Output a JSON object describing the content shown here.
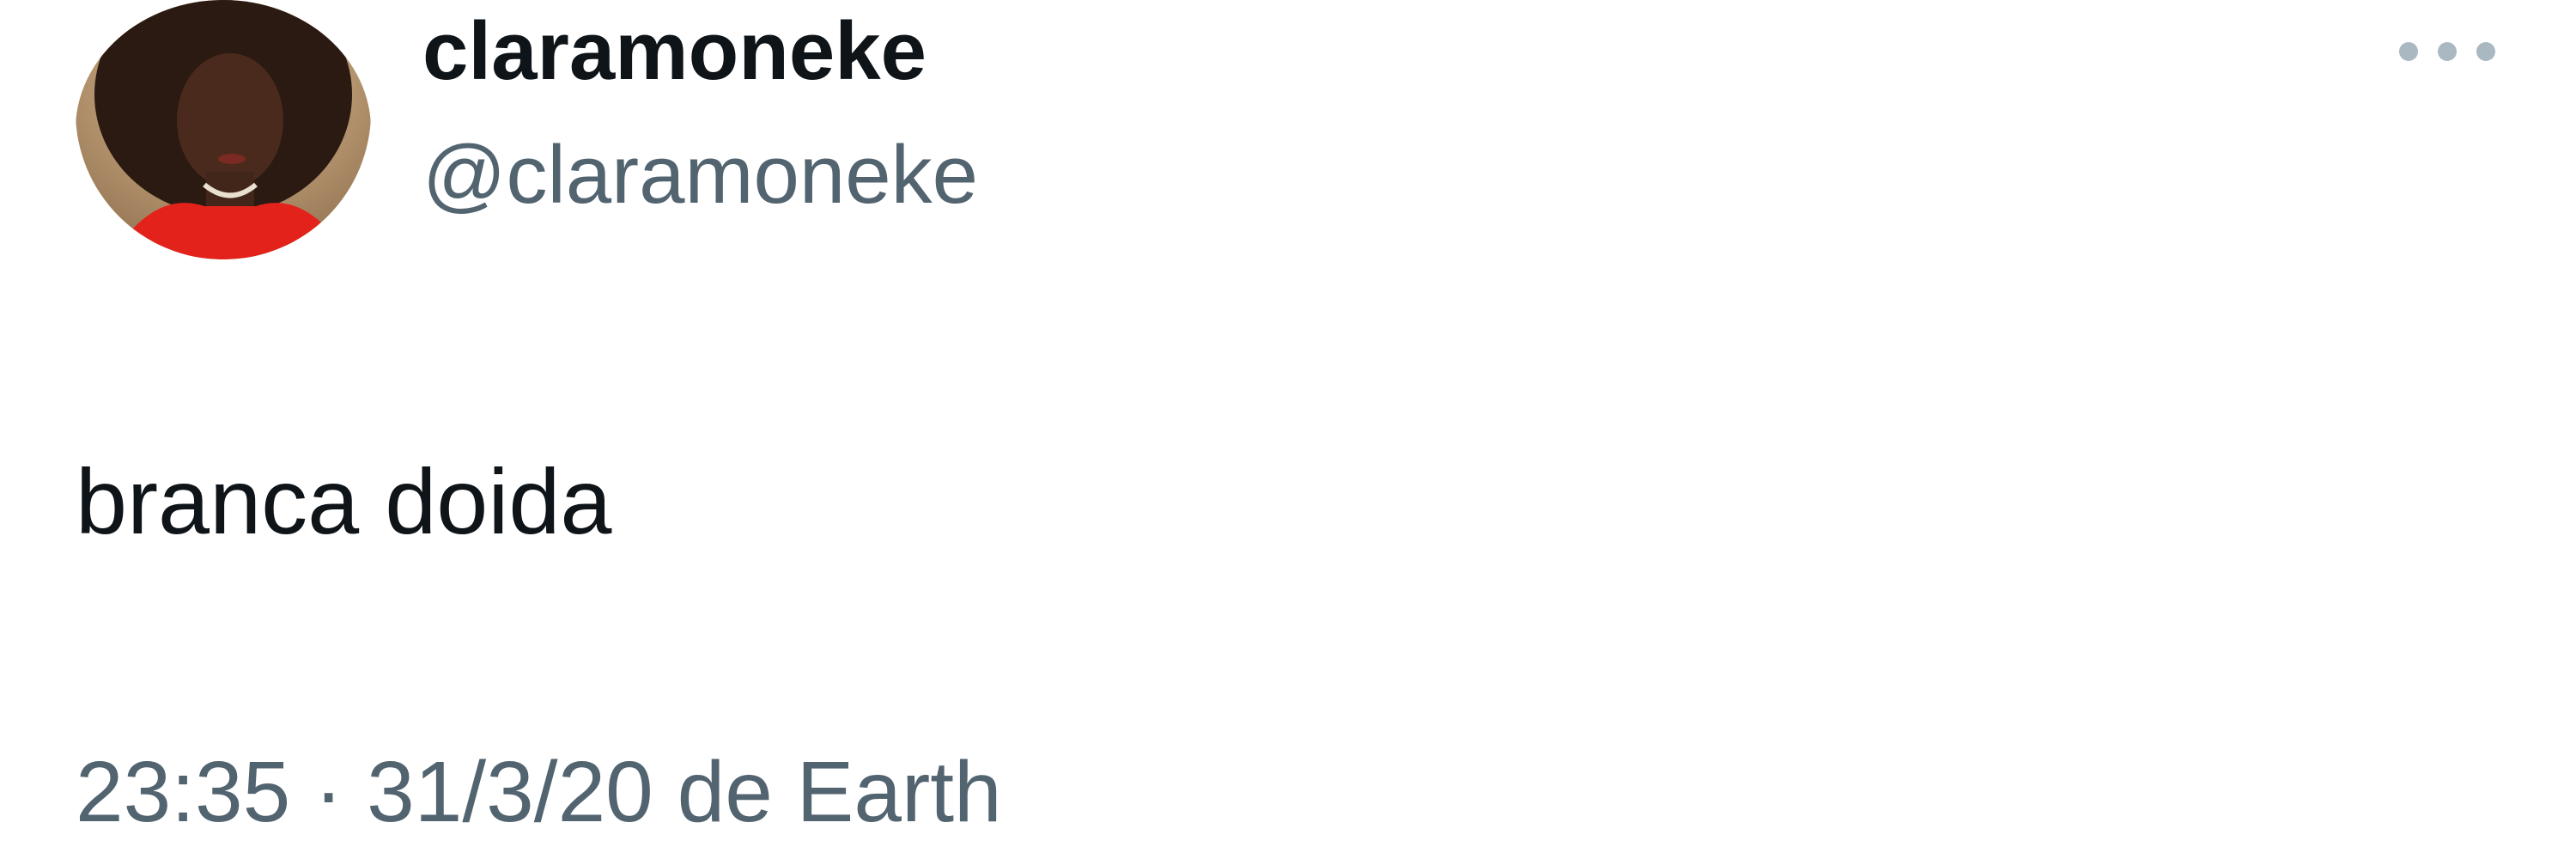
{
  "tweet": {
    "author": {
      "display_name": "claramoneke",
      "handle": "@claramoneke",
      "avatar_icon": "profile-photo"
    },
    "text": "branca doida",
    "timestamp": {
      "time": "23:35",
      "separator": "·",
      "date": "31/3/20",
      "source": "de Earth"
    },
    "more_icon": "more-dots-icon"
  },
  "colors": {
    "primary_text": "#0f1419",
    "secondary_text": "#536471",
    "more_icon": "#aab8c2",
    "background": "#ffffff"
  }
}
